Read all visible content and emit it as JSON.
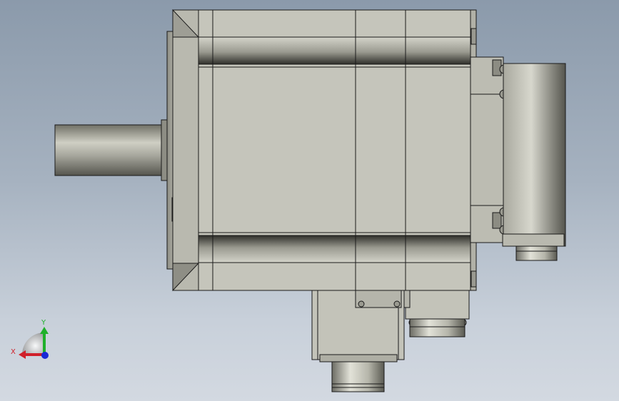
{
  "viewport": {
    "background_top": "#8b9aab",
    "background_bottom": "#d3d9e1"
  },
  "model": {
    "body_color": "#c3c3b9",
    "edge_color": "#1a1a1a",
    "shadow_color": "#4a4a44"
  },
  "triad": {
    "x_label": "X",
    "y_label": "Y",
    "x_color": "#d0202a",
    "y_color": "#1fb02a",
    "z_color": "#1a2ad6"
  }
}
